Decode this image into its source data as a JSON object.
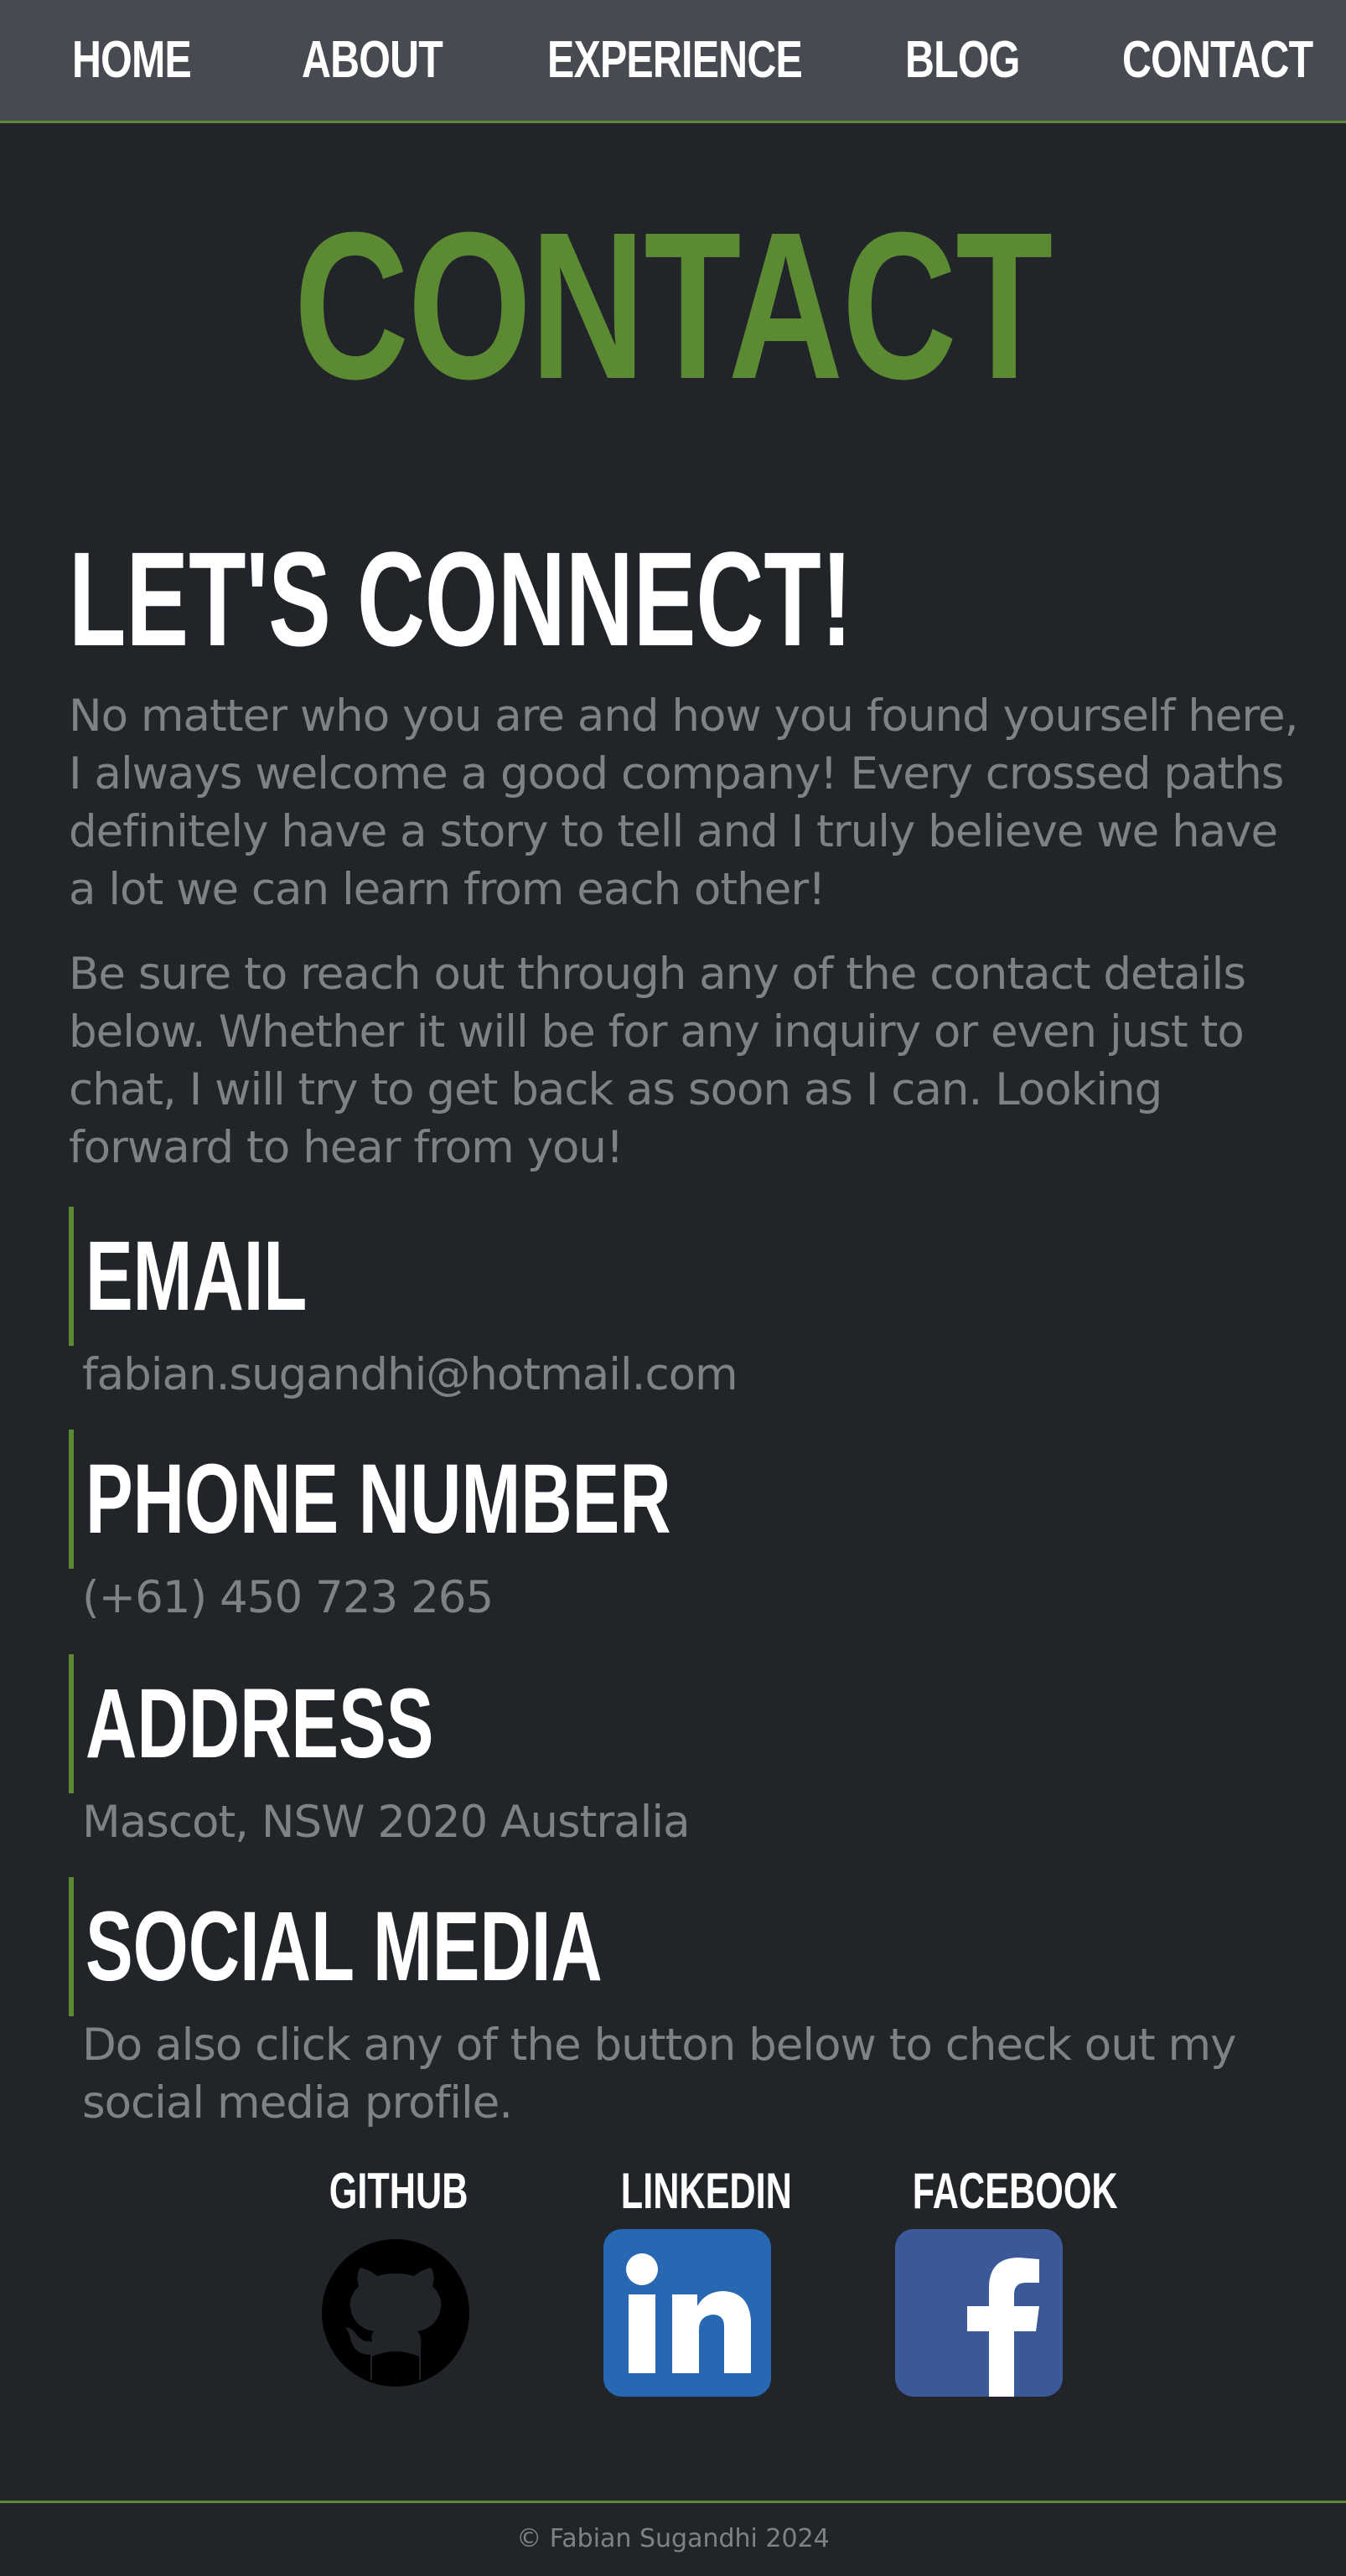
{
  "nav": {
    "items": [
      {
        "label": "HOME"
      },
      {
        "label": "ABOUT"
      },
      {
        "label": "EXPERIENCE"
      },
      {
        "label": "BLOG"
      },
      {
        "label": "CONTACT"
      }
    ]
  },
  "page": {
    "title": "CONTACT",
    "heading": "LET'S CONNECT!",
    "paragraphs": [
      "No matter who you are and how you found yourself here, I always welcome a good company! Every crossed paths definitely have a story to tell and I truly believe we have a lot we can learn from each other!",
      "Be sure to reach out through any of the contact details below. Whether it will be for any inquiry or even just to chat, I will try to get back as soon as I can. Looking forward to hear from you!"
    ]
  },
  "contact": {
    "email": {
      "heading": "EMAIL",
      "value": "fabian.sugandhi@hotmail.com"
    },
    "phone": {
      "heading": "PHONE NUMBER",
      "value": "(+61) 450 723 265"
    },
    "address": {
      "heading": "ADDRESS",
      "value": "Mascot, NSW 2020 Australia"
    },
    "social": {
      "heading": "SOCIAL MEDIA",
      "text": "Do also click any of the button below to check out my social media profile.",
      "links": [
        {
          "label": "GITHUB",
          "icon": "github-icon"
        },
        {
          "label": "LINKEDIN",
          "icon": "linkedin-icon"
        },
        {
          "label": "FACEBOOK",
          "icon": "facebook-icon"
        }
      ]
    }
  },
  "footer": {
    "copyright": "© Fabian Sugandhi 2024"
  },
  "colors": {
    "background": "#212428",
    "nav_background": "#474a50",
    "accent": "#5b8a32",
    "text_muted": "#7f8186",
    "linkedin": "#2867b2",
    "facebook": "#3b5998"
  }
}
